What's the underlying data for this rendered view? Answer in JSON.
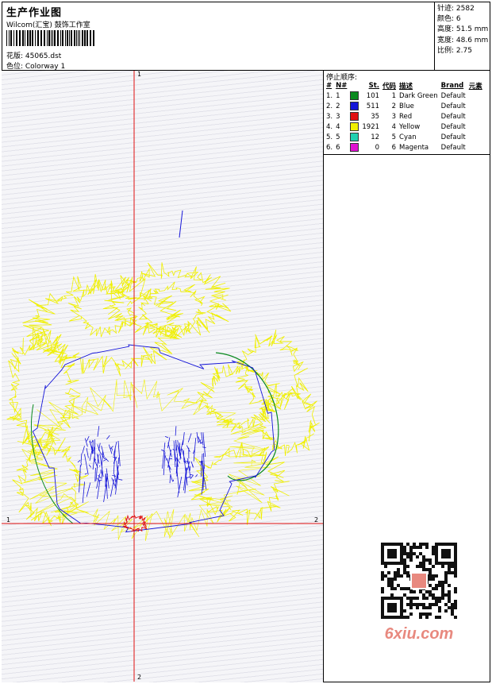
{
  "header": {
    "title": "生产作业图",
    "company": "Wilcom(汇宝) 鼓饰工作室",
    "design_label": "花版: 45065.dst",
    "colorway_label": "色位: Colorway 1"
  },
  "stats": {
    "stitches": "针迹: 2582",
    "colors": "颜色: 6",
    "height": "高度: 51.5 mm",
    "width": "宽度: 48.6 mm",
    "scale": "比例: 2.75"
  },
  "stop_sequence": {
    "title": "停止顺序:",
    "headers": [
      "#",
      "N#",
      "St.",
      "代码",
      "描述",
      "Brand",
      "元素"
    ],
    "rows": [
      {
        "idx": "1.",
        "n": "1",
        "color": "#0a8a1e",
        "st": "101",
        "code": "1",
        "desc": "Dark Green",
        "brand": "Default"
      },
      {
        "idx": "2.",
        "n": "2",
        "color": "#1414d8",
        "st": "511",
        "code": "2",
        "desc": "Blue",
        "brand": "Default"
      },
      {
        "idx": "3.",
        "n": "3",
        "color": "#e01010",
        "st": "35",
        "code": "3",
        "desc": "Red",
        "brand": "Default"
      },
      {
        "idx": "4.",
        "n": "4",
        "color": "#f0f000",
        "st": "1921",
        "code": "4",
        "desc": "Yellow",
        "brand": "Default"
      },
      {
        "idx": "5.",
        "n": "5",
        "color": "#20d0b0",
        "st": "12",
        "code": "5",
        "desc": "Cyan",
        "brand": "Default"
      },
      {
        "idx": "6.",
        "n": "6",
        "color": "#e010d0",
        "st": "0",
        "code": "6",
        "desc": "Magenta",
        "brand": "Default"
      }
    ]
  },
  "axes": {
    "top_label": "1",
    "bottom_label": "2",
    "left_label": "1",
    "right_label": "2",
    "axis_color": "#e01010"
  },
  "watermark": {
    "text": "6xiu.com"
  }
}
